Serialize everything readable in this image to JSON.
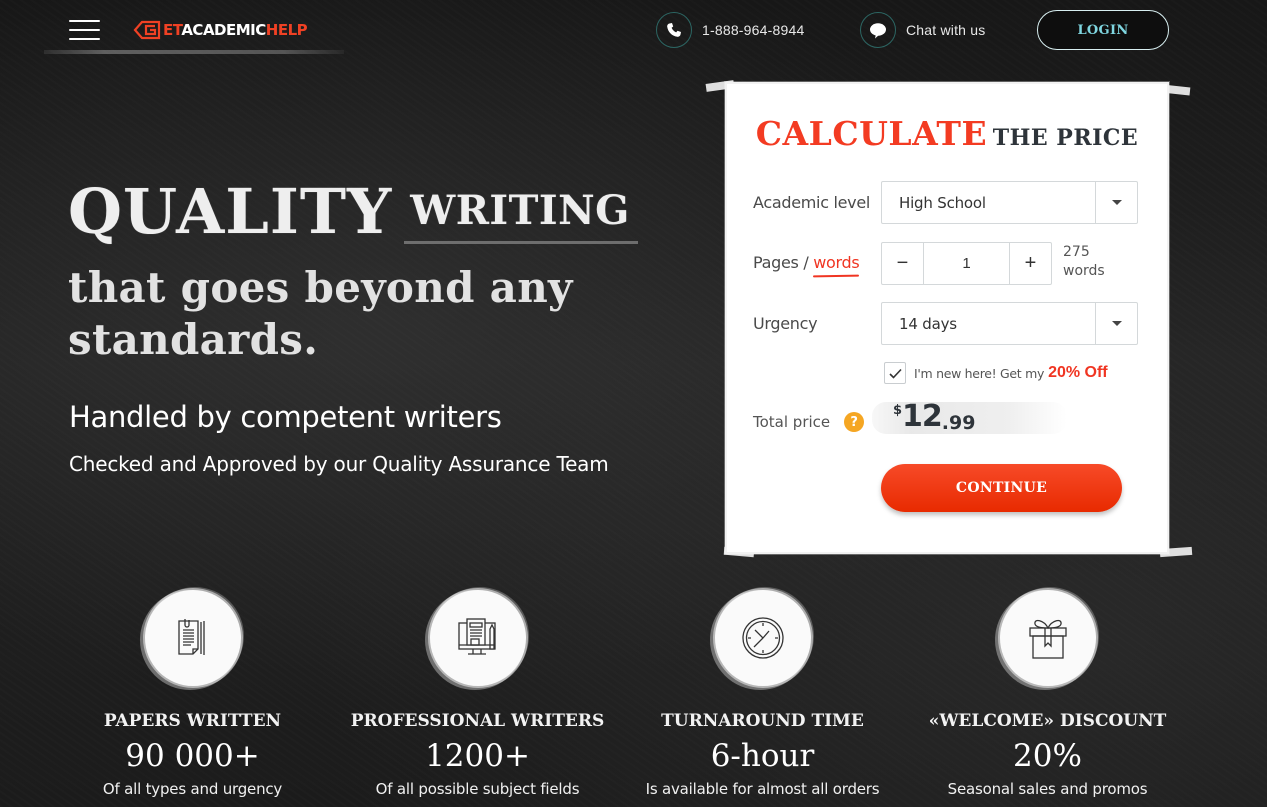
{
  "header": {
    "logo": {
      "prefix_glyph": "G",
      "part1": "ET",
      "part2": "ACADEMIC",
      "part3": "HELP"
    },
    "phone": {
      "icon": "phone-icon",
      "label": "1-888-964-8944"
    },
    "chat": {
      "icon": "chat-bubble-icon",
      "label": "Chat with us"
    },
    "login_label": "LOGIN",
    "menu_icon": "hamburger-menu-icon"
  },
  "hero": {
    "title_big": "QUALITY",
    "title_med": "WRITING",
    "title_line2": "that goes beyond any standards.",
    "subtitle": "Handled by competent writers",
    "subtitle2": "Checked and Approved by our Quality Assurance Team"
  },
  "calculator": {
    "title_accent": "CALCULATE",
    "title_rest": "THE PRICE",
    "academic_level": {
      "label": "Academic level",
      "value": "High School"
    },
    "pages": {
      "label_prefix": "Pages / ",
      "label_link": "words",
      "value": "1",
      "minus": "−",
      "plus": "+",
      "words_count": "275",
      "words_unit": "words"
    },
    "urgency": {
      "label": "Urgency",
      "value": "14 days"
    },
    "promo": {
      "checked": true,
      "text": "I'm new here! Get my",
      "highlight": "20% Off"
    },
    "total": {
      "label": "Total price",
      "help": "?",
      "currency": "$",
      "integer": "12",
      "decimal": ".99"
    },
    "continue_label": "CONTINUE"
  },
  "colors": {
    "accent_red": "#f33b22",
    "login_text": "#7fd6e0",
    "help_orange": "#f5a623",
    "dark_text": "#2e343a"
  },
  "features": [
    {
      "icon": "papers-icon",
      "title": "PAPERS WRITTEN",
      "value": "90 000+",
      "desc": "Of all types and urgency"
    },
    {
      "icon": "writer-desk-icon",
      "title": "PROFESSIONAL WRITERS",
      "value": "1200+",
      "desc": "Of all possible subject fields"
    },
    {
      "icon": "clock-icon",
      "title": "TURNAROUND TIME",
      "value": "6-hour",
      "desc": "Is available for almost all orders"
    },
    {
      "icon": "gift-icon",
      "title": "«WELCOME» DISCOUNT",
      "value": "20%",
      "desc": "Seasonal sales and promos"
    }
  ]
}
